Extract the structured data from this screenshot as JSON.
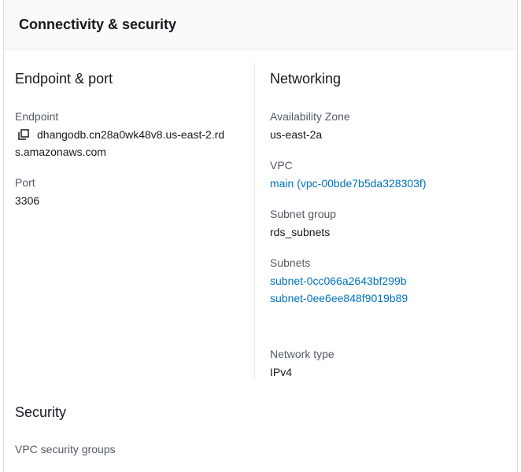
{
  "panel": {
    "title": "Connectivity & security"
  },
  "endpoint_section": {
    "heading": "Endpoint & port",
    "endpoint_label": "Endpoint",
    "endpoint_line1": "dhangodb.cn28a0wk48v8.us-east-2.rd",
    "endpoint_line2": "s.amazonaws.com",
    "copy_icon": "copy-icon",
    "port_label": "Port",
    "port_value": "3306"
  },
  "networking_section": {
    "heading": "Networking",
    "az_label": "Availability Zone",
    "az_value": "us-east-2a",
    "vpc_label": "VPC",
    "vpc_value": "main (vpc-00bde7b5da328303f)",
    "subnet_group_label": "Subnet group",
    "subnet_group_value": "rds_subnets",
    "subnets_label": "Subnets",
    "subnets": [
      "subnet-0cc066a2643bf299b",
      "subnet-0ee6ee848f9019b89"
    ],
    "network_type_label": "Network type",
    "network_type_value": "IPv4"
  },
  "security_section": {
    "heading": "Security",
    "vpc_sg_label": "VPC security groups"
  },
  "colors": {
    "link": "#0073bb",
    "label": "#545b64",
    "text": "#16191f",
    "header_bg": "#fafafa",
    "border": "#d5dbdb"
  }
}
